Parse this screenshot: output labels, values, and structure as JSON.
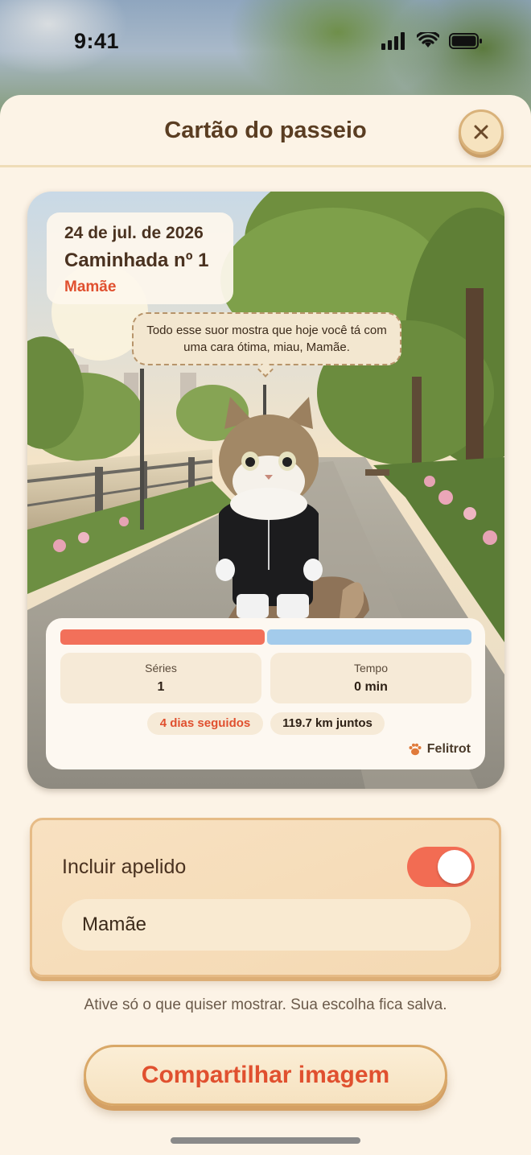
{
  "status_bar": {
    "time": "9:41"
  },
  "sheet": {
    "title": "Cartão do passeio"
  },
  "card": {
    "date": "24 de jul. de 2026",
    "walk_title": "Caminhada nº 1",
    "nickname": "Mamãe",
    "speech": "Todo esse suor mostra que hoje você tá com uma cara ótima, miau, Mamãe.",
    "progress": {
      "red_fraction": 0.5,
      "blue_fraction": 0.5
    },
    "stats": [
      {
        "label": "Séries",
        "value": "1"
      },
      {
        "label": "Tempo",
        "value": "0 min"
      }
    ],
    "chips": {
      "streak": "4 dias seguidos",
      "distance": "119.7 km juntos"
    },
    "brand": "Felitrot"
  },
  "nickname_panel": {
    "label": "Incluir apelido",
    "toggle_on": true,
    "input_value": "Mamãe"
  },
  "hint": "Ative só o que quiser mostrar. Sua escolha fica salva.",
  "share_button": "Compartilhar imagem",
  "colors": {
    "accent": "#e0502f",
    "toggle": "#f26c53",
    "bar_red": "#f2705a",
    "bar_blue": "#a3cbeb",
    "sheet_bg": "#fcf3e6"
  }
}
